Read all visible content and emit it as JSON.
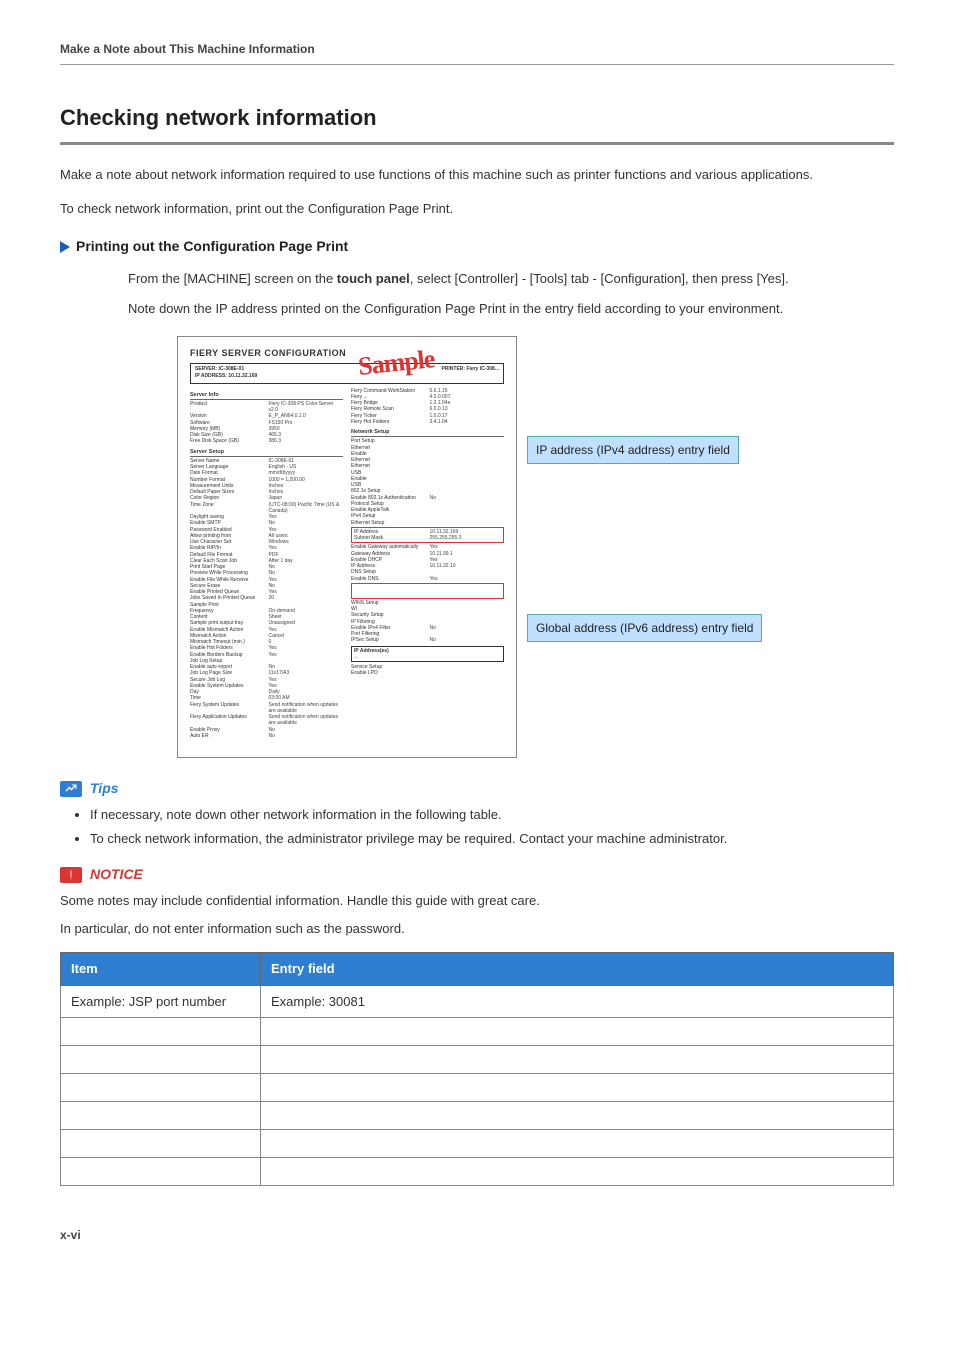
{
  "header": {
    "title": "Make a Note about This Machine Information"
  },
  "page": {
    "h1": "Checking network information",
    "intro1": "Make a note about network information required to use functions of this machine such as printer functions and various applications.",
    "intro2": "To check network information, print out the Configuration Page Print.",
    "sub_heading": "Printing out the Configuration Page Print",
    "step_prefix": "From the [MACHINE] screen on the ",
    "step_bold": "touch panel",
    "step_suffix": ", select [Controller] - [Tools] tab - [Configuration], then press [Yes].",
    "step2": "Note down the IP address printed on the Configuration Page Print in the entry field according to your environment."
  },
  "figure": {
    "title": "FIERY SERVER CONFIGURATION",
    "bar_left": "SERVER: IC-308E-01\nIP ADDRESS: 10.11.32.169",
    "bar_right_label": "PRINTER:",
    "bar_right_value": "Fiery IC-308...",
    "stamp": "Sample",
    "callout_ipv4": "IP address (IPv4 address) entry field",
    "callout_ipv6": "Global address (IPv6 address) entry field",
    "server_info_label": "Server Info",
    "server_info_rows": [
      [
        "Product",
        "Fiery IC-308 PS Color Server v2.0"
      ],
      [
        "Version",
        "E_P_AN64.0.1.0"
      ],
      [
        "Software",
        "FS150 Pro"
      ],
      [
        "Memory (MB)",
        "3950"
      ],
      [
        "Disk Size (GB)",
        "465.3"
      ],
      [
        "Free Disk Space (GB)",
        "386.3"
      ]
    ],
    "server_setup_label": "Server Setup",
    "server_setup_rows": [
      [
        "Server Name",
        "IC-308E-01"
      ],
      [
        "Server Language",
        "English - US"
      ],
      [
        "Date Format",
        "mm/dd/yyyy"
      ],
      [
        "Number Format",
        "1000 = 1,200.00"
      ],
      [
        "Measurement Units",
        "Inches"
      ],
      [
        "Default Paper Sizes",
        "Inches"
      ],
      [
        "Color Region",
        "Japan"
      ],
      [
        "Time Zone",
        "(UTC-08:00) Pacific Time (US & Canada)"
      ],
      [
        "Daylight saving",
        "Yes"
      ],
      [
        "Enable SMTP",
        "No"
      ],
      [
        "Password Enabled",
        "Yes"
      ],
      [
        "Allow printing from",
        "All users"
      ],
      [
        "Use Character Set",
        "Windows"
      ],
      [
        "Enable RIP/In",
        "Yes"
      ],
      [
        "Default File Format",
        "PDF"
      ],
      [
        "Clear Each Scan Job",
        "After 1 day"
      ],
      [
        "Print Start Page",
        "No"
      ],
      [
        "Preview While Processing",
        "No"
      ],
      [
        "Enable File While Receive",
        "Yes"
      ],
      [
        "Secure Erase",
        "No"
      ],
      [
        "Enable Printed Queue",
        "Yes"
      ],
      [
        "Jobs Saved In Printed Queue",
        "20"
      ],
      [
        "Sample Print",
        ""
      ],
      [
        "Frequency",
        "On-demand"
      ],
      [
        "Content",
        "Sheet"
      ],
      [
        "Sample print output tray",
        "Unassigned"
      ],
      [
        "Enable Mismatch Action",
        "Yes"
      ],
      [
        "Mismatch Action",
        "Cancel"
      ],
      [
        "Mismatch Timeout (min.)",
        "0"
      ],
      [
        "Enable Hot Folders",
        "Yes"
      ],
      [
        "Enable Borders Backup",
        "Yes"
      ],
      [
        "Job Log Setup",
        ""
      ],
      [
        "Enable auto export",
        "No"
      ],
      [
        "Job Log Page Size",
        "11x17/A3"
      ],
      [
        "Secure Job Log",
        "Yes"
      ],
      [
        "Enable System Updates",
        "Yes"
      ],
      [
        "Day",
        "Daily"
      ],
      [
        "Time",
        "03:00 AM"
      ],
      [
        "Fiery System Updates",
        "Send notification when updates are available"
      ],
      [
        "Fiery Application Updates",
        "Send notification when updates are available"
      ],
      [
        "Enable Proxy",
        "No"
      ],
      [
        "Auto ER",
        "No"
      ]
    ],
    "right_top_rows": [
      [
        "Fiery Command WorkStation",
        "5.6.1.15"
      ],
      [
        "Fiery ...",
        "4.0.0.007"
      ],
      [
        "Fiery Bridge",
        "1.2.1.04e"
      ],
      [
        "Fiery Remote Scan",
        "6.0.0.13"
      ],
      [
        "Fiery Ticker",
        "1.0.0.17"
      ],
      [
        "Fiery Hot Folders",
        "3.4.1.04"
      ]
    ],
    "network_setup_label": "Network Setup",
    "network_rows_a": [
      [
        "Port Setup",
        ""
      ],
      [
        "Ethernet",
        ""
      ],
      [
        "Enable",
        ""
      ],
      [
        "Ethernet",
        ""
      ],
      [
        "Ethernet",
        ""
      ],
      [
        "USB",
        ""
      ],
      [
        "Enable",
        ""
      ],
      [
        "USB",
        ""
      ],
      [
        "802.1x Setup",
        ""
      ],
      [
        "Enable 802.1x Authentication",
        "No"
      ],
      [
        "Protocol Setup",
        ""
      ],
      [
        "Enable AppleTalk",
        ""
      ],
      [
        "IPv4 Setup",
        ""
      ],
      [
        "Ethernet Setup",
        ""
      ]
    ],
    "ipv4_box_rows": [
      [
        "IP Address",
        "10.11.32.169"
      ],
      [
        "Subnet Mask",
        "255.255.255.0"
      ]
    ],
    "network_rows_b": [
      [
        "Enable Gateway automatically",
        "Yes"
      ],
      [
        "Gateway Address",
        "10.11.99.1"
      ],
      [
        "Enable DHCP",
        "Yes"
      ],
      [
        "IP Address",
        "10.11.32.10"
      ],
      [
        "DNS Setup",
        ""
      ],
      [
        "Enable DNS",
        "Yes"
      ]
    ],
    "network_rows_c": [
      [
        "WINS Setup",
        ""
      ],
      [
        "WI",
        ""
      ],
      [
        "Security Setup",
        ""
      ],
      [
        "IP Filtering",
        ""
      ],
      [
        "Enable IPv4 Filter",
        "No"
      ],
      [
        "Port Filtering",
        ""
      ],
      [
        "IPSec Setup",
        "No"
      ]
    ],
    "ip_addresses_label": "IP Address(es)",
    "ip_addresses_value": "...",
    "service_setup_rows": [
      [
        "Service Setup",
        ""
      ],
      [
        "Enable LPD",
        ""
      ]
    ]
  },
  "tips": {
    "heading": "Tips",
    "items": [
      "If necessary, note down other network information in the following table.",
      "To check network information, the administrator privilege may be required. Contact your machine administrator."
    ]
  },
  "notice": {
    "heading": "NOTICE",
    "line1": "Some notes may include confidential information. Handle this guide with great care.",
    "line2": "In particular, do not enter information such as the password."
  },
  "table": {
    "headers": [
      "Item",
      "Entry field"
    ],
    "example_row": [
      "Example: JSP port number",
      "Example: 30081"
    ],
    "blank_rows": 6
  },
  "footer": {
    "page_num": "x-vi"
  }
}
